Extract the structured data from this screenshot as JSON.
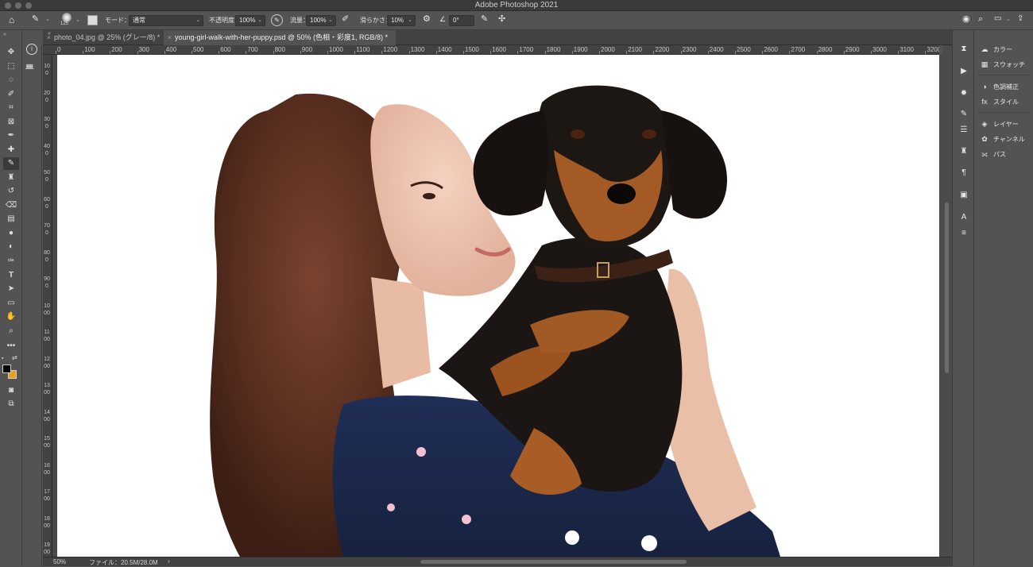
{
  "app": {
    "title": "Adobe Photoshop 2021"
  },
  "options_bar": {
    "brush_size": "125",
    "mode_label": "モード：",
    "mode_value": "通常",
    "opacity_label": "不透明度：",
    "opacity_value": "100%",
    "flow_label": "流量：",
    "flow_value": "100%",
    "smoothing_label": "滑らかさ：",
    "smoothing_value": "10%",
    "angle_value": "0°"
  },
  "tabs": [
    {
      "label": "photo_04.jpg @ 25% (グレー/8) *",
      "close": "×",
      "active": false
    },
    {
      "label": "young-girl-walk-with-her-puppy.psd @ 50% (色相・彩度1, RGB/8) *",
      "close": "×",
      "active": true
    }
  ],
  "ruler": {
    "h_labels": [
      "0",
      "100",
      "200",
      "300",
      "400",
      "500",
      "600",
      "700",
      "800",
      "900",
      "1000",
      "1100",
      "1200",
      "1300",
      "1400",
      "1500",
      "1600",
      "1700",
      "1800",
      "1900",
      "2000",
      "2100",
      "2200",
      "2300",
      "2400",
      "2500",
      "2600",
      "2700",
      "2800",
      "2900",
      "3000",
      "3100",
      "3200"
    ],
    "v_labels": [
      "100",
      "200",
      "300",
      "400",
      "500",
      "600",
      "700",
      "800",
      "900",
      "1000",
      "1100",
      "1200",
      "1300",
      "1400",
      "1500",
      "1600",
      "1700",
      "1800",
      "1900"
    ]
  },
  "status": {
    "zoom": "50%",
    "file_info": "ファイル：20.5M/28.0M",
    "arrow": "›"
  },
  "panels": [
    {
      "label": "カラー",
      "icon": "color-icon"
    },
    {
      "label": "スウォッチ",
      "icon": "swatches-icon"
    },
    {
      "label": "色調補正",
      "icon": "adjustments-icon"
    },
    {
      "label": "スタイル",
      "icon": "styles-icon"
    },
    {
      "label": "レイヤー",
      "icon": "layers-icon"
    },
    {
      "label": "チャンネル",
      "icon": "channels-icon"
    },
    {
      "label": "パス",
      "icon": "paths-icon"
    }
  ],
  "colors": {
    "foreground": "#000000",
    "background": "#e8a020",
    "ui_dark": "#535353"
  }
}
